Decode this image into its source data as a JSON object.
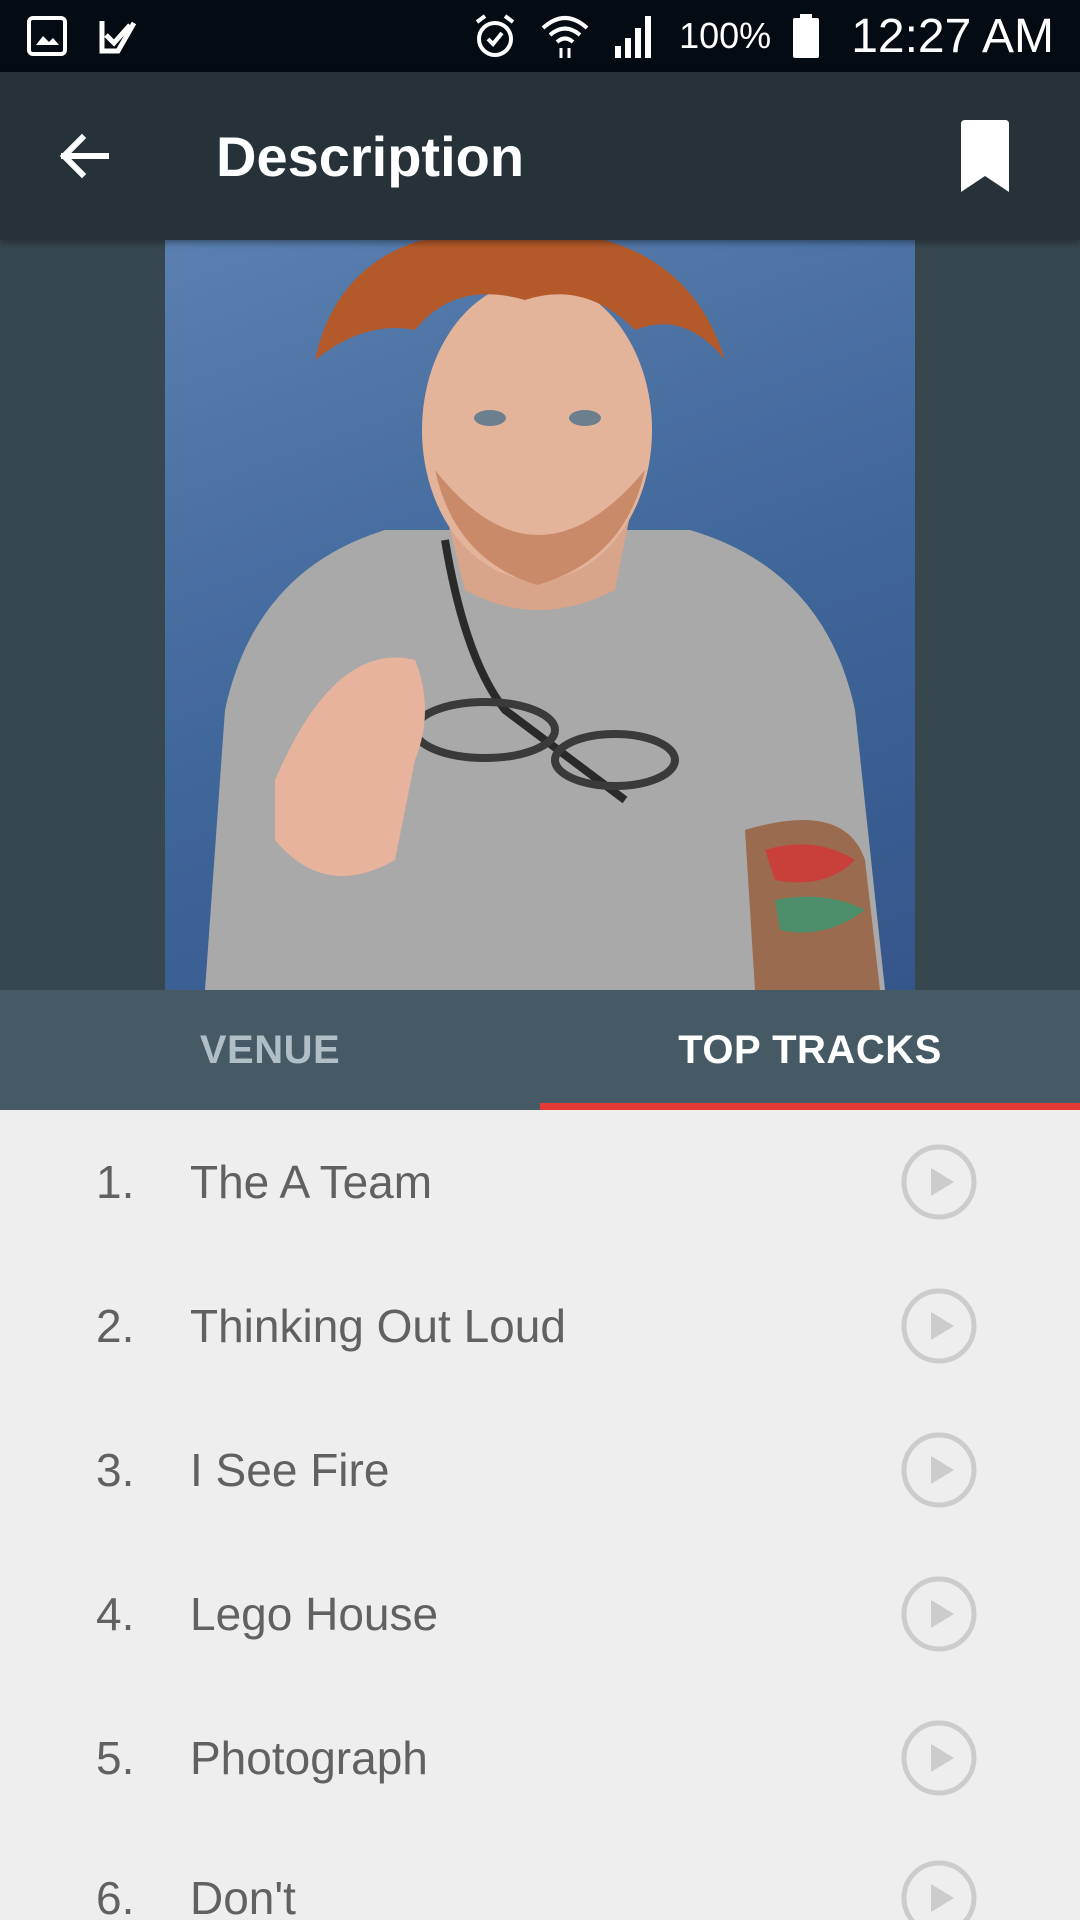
{
  "status_bar": {
    "battery_text": "100%",
    "time": "12:27 AM",
    "icons": [
      "gallery-icon",
      "check-icon",
      "alarm-icon",
      "wifi-icon",
      "signal-icon",
      "battery-icon"
    ]
  },
  "app_bar": {
    "title": "Description",
    "back_icon": "arrow-back-icon",
    "bookmark_icon": "bookmark-icon"
  },
  "colors": {
    "status_bar": "#050b12",
    "app_bar": "#263238",
    "hero_bg": "#37474f",
    "tabs_bg": "#455a64",
    "tab_indicator": "#e53935",
    "list_bg": "#eeeeee",
    "list_text": "#616161"
  },
  "tabs": [
    {
      "label": "VENUE",
      "selected": false
    },
    {
      "label": "TOP TRACKS",
      "selected": true
    }
  ],
  "tracks": [
    {
      "number": "1.",
      "title": "The A Team"
    },
    {
      "number": "2.",
      "title": "Thinking Out Loud"
    },
    {
      "number": "3.",
      "title": "I See Fire"
    },
    {
      "number": "4.",
      "title": "Lego House"
    },
    {
      "number": "5.",
      "title": "Photograph"
    },
    {
      "number": "6.",
      "title": "Don't"
    }
  ]
}
